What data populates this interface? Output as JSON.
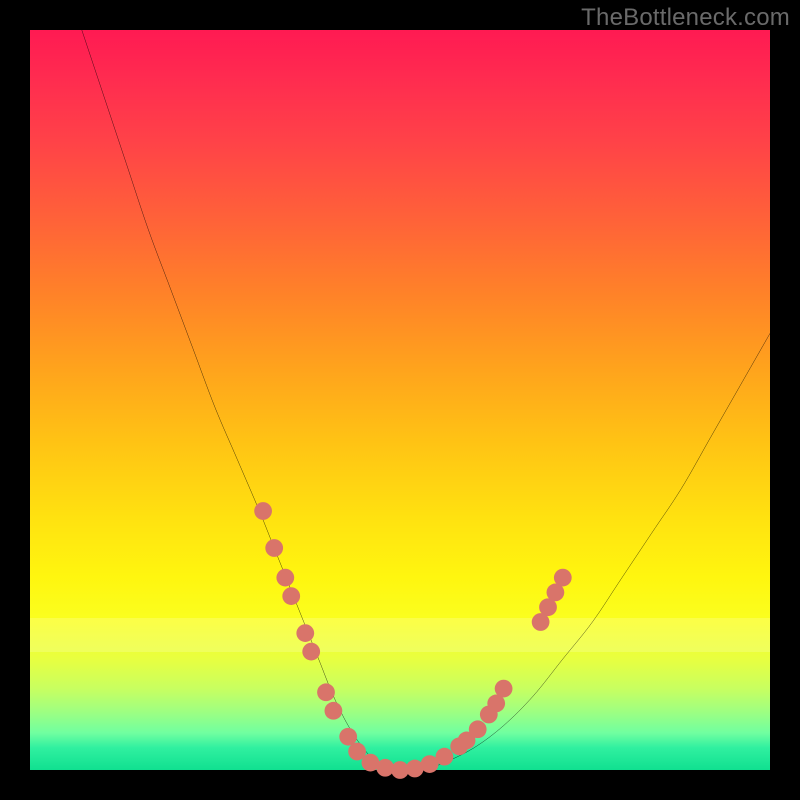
{
  "watermark": "TheBottleneck.com",
  "chart_data": {
    "type": "line",
    "title": "",
    "xlabel": "",
    "ylabel": "",
    "xlim": [
      0,
      100
    ],
    "ylim": [
      0,
      100
    ],
    "grid": false,
    "legend": false,
    "series": [
      {
        "name": "bottleneck-curve",
        "x": [
          7,
          10,
          13,
          16,
          19,
          22,
          25,
          28,
          31,
          33,
          35,
          37,
          39,
          41,
          43,
          45,
          47,
          50,
          53,
          56,
          60,
          64,
          68,
          72,
          76,
          80,
          84,
          88,
          92,
          96,
          100
        ],
        "y": [
          100,
          91,
          82,
          73,
          65,
          57,
          49,
          42,
          35,
          30,
          25,
          20,
          15,
          10,
          6,
          3,
          1,
          0,
          0,
          1,
          3,
          6,
          10,
          15,
          20,
          26,
          32,
          38,
          45,
          52,
          59
        ]
      }
    ],
    "markers": [
      {
        "x": 31.5,
        "y": 35.0
      },
      {
        "x": 33.0,
        "y": 30.0
      },
      {
        "x": 34.5,
        "y": 26.0
      },
      {
        "x": 35.3,
        "y": 23.5
      },
      {
        "x": 37.2,
        "y": 18.5
      },
      {
        "x": 38.0,
        "y": 16.0
      },
      {
        "x": 40.0,
        "y": 10.5
      },
      {
        "x": 41.0,
        "y": 8.0
      },
      {
        "x": 43.0,
        "y": 4.5
      },
      {
        "x": 44.2,
        "y": 2.5
      },
      {
        "x": 46.0,
        "y": 1.0
      },
      {
        "x": 48.0,
        "y": 0.3
      },
      {
        "x": 50.0,
        "y": 0.0
      },
      {
        "x": 52.0,
        "y": 0.2
      },
      {
        "x": 54.0,
        "y": 0.8
      },
      {
        "x": 56.0,
        "y": 1.8
      },
      {
        "x": 58.0,
        "y": 3.2
      },
      {
        "x": 59.0,
        "y": 4.0
      },
      {
        "x": 60.5,
        "y": 5.5
      },
      {
        "x": 62.0,
        "y": 7.5
      },
      {
        "x": 63.0,
        "y": 9.0
      },
      {
        "x": 64.0,
        "y": 11.0
      },
      {
        "x": 69.0,
        "y": 20.0
      },
      {
        "x": 70.0,
        "y": 22.0
      },
      {
        "x": 71.0,
        "y": 24.0
      },
      {
        "x": 72.0,
        "y": 26.0
      }
    ],
    "marker_color": "#d9746a",
    "marker_radius": 1.2
  }
}
